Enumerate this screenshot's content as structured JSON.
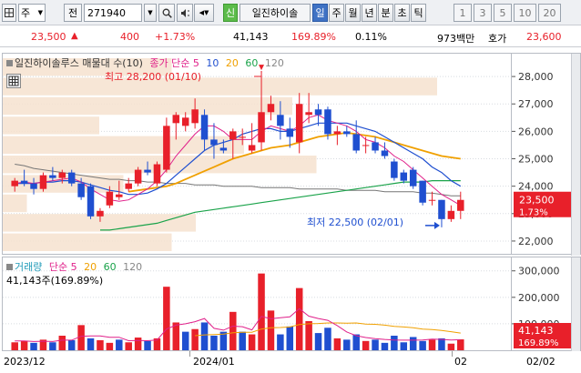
{
  "toolbar": {
    "market_label": "주",
    "field_label": "전",
    "code_value": "271940",
    "credit_badge": "신",
    "stock_name": "일진하이솔",
    "periods": [
      "일",
      "주",
      "월",
      "년",
      "분",
      "초",
      "틱"
    ],
    "selected_period": "일",
    "intervals": [
      "1",
      "3",
      "5",
      "10",
      "20"
    ]
  },
  "quote": {
    "price": "23,500",
    "change_arrow": "▲",
    "change": "400",
    "change_pct": "+1.73%",
    "volume": "41,143",
    "volume_ratio": "169.89%",
    "turnover": "0.11%",
    "amount": "973백만",
    "ask_label": "호가",
    "ask_price": "23,600"
  },
  "price_panel": {
    "legend_name": "일진하이솔루스 매물대 수(10)",
    "legend_close": "종가 단순",
    "ma_periods": [
      "5",
      "10",
      "20",
      "60",
      "120"
    ],
    "high_annotation": "최고 28,200 (01/10)",
    "low_annotation": "최저 22,500 (02/01)"
  },
  "price_axis": {
    "ticks": [
      "28,000",
      "27,000",
      "26,000",
      "25,000",
      "24,000",
      "23,000",
      "22,000"
    ],
    "current_price": "23,500",
    "current_pct": "1.73%"
  },
  "volume_panel": {
    "legend_name": "거래량",
    "legend_ma": "단순",
    "ma_periods": [
      "5",
      "20",
      "60",
      "120"
    ],
    "current_label": "41,143주(169.89%)"
  },
  "volume_axis": {
    "ticks": [
      "300,000",
      "200,000",
      "100,000"
    ],
    "current_volume": "41,143",
    "current_pct": "169.89%"
  },
  "date_axis": {
    "labels": [
      "2023/12",
      "2024/01",
      "02",
      "02/02"
    ]
  },
  "colors": {
    "up": "#e8202a",
    "down": "#1f4fd0",
    "ma5": "#e0208a",
    "ma10": "#1f4fd0",
    "ma20": "#f0a000",
    "ma60": "#1aa34a",
    "ma120": "#777777",
    "volume_profile": "#f6e2cf"
  },
  "chart_data": {
    "type": "candlestick",
    "ylim": [
      21600,
      28700
    ],
    "volume_ylim": [
      0,
      330000
    ],
    "candles": [
      {
        "o": 24000,
        "h": 24300,
        "l": 23800,
        "c": 24200
      },
      {
        "o": 24200,
        "h": 24600,
        "l": 24000,
        "c": 24100
      },
      {
        "o": 24100,
        "h": 24300,
        "l": 23700,
        "c": 23900
      },
      {
        "o": 23900,
        "h": 24500,
        "l": 23800,
        "c": 24400
      },
      {
        "o": 24400,
        "h": 24700,
        "l": 24200,
        "c": 24300
      },
      {
        "o": 24300,
        "h": 24600,
        "l": 24100,
        "c": 24500
      },
      {
        "o": 24500,
        "h": 24600,
        "l": 24000,
        "c": 24100
      },
      {
        "o": 24100,
        "h": 24300,
        "l": 23500,
        "c": 23600
      },
      {
        "o": 24000,
        "h": 24100,
        "l": 22800,
        "c": 22900
      },
      {
        "o": 22900,
        "h": 23200,
        "l": 22700,
        "c": 23100
      },
      {
        "o": 23300,
        "h": 24000,
        "l": 23200,
        "c": 23800
      },
      {
        "o": 23600,
        "h": 24200,
        "l": 23500,
        "c": 23700
      },
      {
        "o": 23900,
        "h": 24300,
        "l": 23800,
        "c": 24100
      },
      {
        "o": 24100,
        "h": 24700,
        "l": 24000,
        "c": 24600
      },
      {
        "o": 24600,
        "h": 24900,
        "l": 24400,
        "c": 24500
      },
      {
        "o": 24100,
        "h": 24900,
        "l": 24000,
        "c": 24800
      },
      {
        "o": 24600,
        "h": 26500,
        "l": 24500,
        "c": 26200
      },
      {
        "o": 26300,
        "h": 26700,
        "l": 25700,
        "c": 26600
      },
      {
        "o": 26200,
        "h": 26700,
        "l": 26000,
        "c": 26500
      },
      {
        "o": 26300,
        "h": 27200,
        "l": 26100,
        "c": 26800
      },
      {
        "o": 26600,
        "h": 26800,
        "l": 25300,
        "c": 25700
      },
      {
        "o": 25700,
        "h": 26300,
        "l": 25000,
        "c": 25500
      },
      {
        "o": 25400,
        "h": 25700,
        "l": 25200,
        "c": 25300
      },
      {
        "o": 25700,
        "h": 26100,
        "l": 25000,
        "c": 26000
      },
      {
        "o": 25800,
        "h": 26100,
        "l": 25500,
        "c": 25800
      },
      {
        "o": 25300,
        "h": 26300,
        "l": 25200,
        "c": 25500
      },
      {
        "o": 25600,
        "h": 28200,
        "l": 25300,
        "c": 26700
      },
      {
        "o": 26700,
        "h": 27300,
        "l": 26400,
        "c": 27000
      },
      {
        "o": 26600,
        "h": 27100,
        "l": 25700,
        "c": 26200
      },
      {
        "o": 26100,
        "h": 26500,
        "l": 25400,
        "c": 25800
      },
      {
        "o": 25600,
        "h": 27400,
        "l": 25200,
        "c": 27000
      },
      {
        "o": 26600,
        "h": 27400,
        "l": 26300,
        "c": 26700
      },
      {
        "o": 26800,
        "h": 27000,
        "l": 26200,
        "c": 26600
      },
      {
        "o": 26800,
        "h": 26900,
        "l": 25700,
        "c": 25900
      },
      {
        "o": 25900,
        "h": 26200,
        "l": 25500,
        "c": 26000
      },
      {
        "o": 26000,
        "h": 26200,
        "l": 25800,
        "c": 25900
      },
      {
        "o": 25900,
        "h": 26400,
        "l": 25200,
        "c": 25300
      },
      {
        "o": 25500,
        "h": 25800,
        "l": 25200,
        "c": 25500
      },
      {
        "o": 25600,
        "h": 25800,
        "l": 25200,
        "c": 25300
      },
      {
        "o": 25300,
        "h": 25600,
        "l": 25000,
        "c": 25100
      },
      {
        "o": 24900,
        "h": 25000,
        "l": 24200,
        "c": 24300
      },
      {
        "o": 24500,
        "h": 24600,
        "l": 24100,
        "c": 24200
      },
      {
        "o": 24600,
        "h": 24700,
        "l": 23900,
        "c": 24000
      },
      {
        "o": 24200,
        "h": 24200,
        "l": 23300,
        "c": 23400
      },
      {
        "o": 23500,
        "h": 23800,
        "l": 23300,
        "c": 23500
      },
      {
        "o": 23500,
        "h": 23500,
        "l": 22500,
        "c": 22800
      },
      {
        "o": 22800,
        "h": 23300,
        "l": 22700,
        "c": 23100
      },
      {
        "o": 23100,
        "h": 23800,
        "l": 22800,
        "c": 23500
      }
    ],
    "volume": [
      30000,
      35000,
      28000,
      40000,
      30000,
      55000,
      38000,
      95000,
      45000,
      38000,
      28000,
      40000,
      30000,
      48000,
      35000,
      45000,
      240000,
      105000,
      70000,
      80000,
      105000,
      55000,
      70000,
      145000,
      70000,
      60000,
      290000,
      150000,
      60000,
      90000,
      235000,
      110000,
      65000,
      85000,
      45000,
      40000,
      60000,
      35000,
      40000,
      28000,
      55000,
      30000,
      50000,
      35000,
      40000,
      45000,
      25000,
      41143
    ],
    "volume_is_up": [
      true,
      true,
      false,
      true,
      false,
      true,
      false,
      true,
      false,
      true,
      true,
      false,
      true,
      true,
      false,
      true,
      true,
      true,
      false,
      true,
      false,
      false,
      false,
      true,
      false,
      true,
      true,
      true,
      false,
      false,
      true,
      true,
      false,
      false,
      true,
      false,
      false,
      true,
      false,
      false,
      false,
      false,
      false,
      false,
      true,
      false,
      true,
      true
    ],
    "ma5": [
      24100,
      24150,
      24100,
      24150,
      24200,
      24250,
      24300,
      24150,
      23900,
      23700,
      23500,
      23450,
      23500,
      23700,
      23900,
      24200,
      24600,
      25100,
      25500,
      25900,
      26200,
      26200,
      26000,
      25700,
      25700,
      25700,
      26000,
      26200,
      26100,
      26000,
      26200,
      26500,
      26600,
      26400,
      26300,
      26200,
      26000,
      25700,
      25600,
      25400,
      25100,
      24900,
      24600,
      24300,
      24000,
      23700,
      23500,
      23300
    ],
    "ma10": [
      24100,
      24100,
      24100,
      24150,
      24150,
      24200,
      24200,
      24150,
      24050,
      23950,
      23850,
      23800,
      23700,
      23700,
      23750,
      23900,
      24100,
      24400,
      24700,
      25000,
      25300,
      25500,
      25600,
      25700,
      25900,
      26000,
      26100,
      26100,
      26000,
      26000,
      26100,
      26200,
      26300,
      26300,
      26300,
      26300,
      26200,
      26100,
      26000,
      25800,
      25600,
      25400,
      25200,
      25000,
      24700,
      24500,
      24200,
      24000
    ],
    "ma20": [
      null,
      null,
      null,
      null,
      null,
      null,
      null,
      null,
      null,
      null,
      null,
      null,
      23800,
      23850,
      23900,
      23950,
      24000,
      24100,
      24250,
      24400,
      24550,
      24700,
      24850,
      25000,
      25100,
      25200,
      25300,
      25400,
      25450,
      25500,
      25600,
      25700,
      25800,
      25850,
      25900,
      25950,
      25900,
      25850,
      25800,
      25700,
      25600,
      25500,
      25400,
      25300,
      25200,
      25100,
      25050,
      25000
    ],
    "ma60": [
      null,
      null,
      null,
      null,
      null,
      null,
      null,
      null,
      null,
      22400,
      22400,
      22450,
      22500,
      22550,
      22600,
      22650,
      22750,
      22850,
      22950,
      23050,
      23100,
      23150,
      23200,
      23250,
      23300,
      23350,
      23400,
      23450,
      23500,
      23550,
      23600,
      23650,
      23700,
      23750,
      23800,
      23850,
      23900,
      23950,
      24000,
      24050,
      24100,
      24150,
      24150,
      24150,
      24200,
      24200,
      24200,
      24200
    ],
    "ma120": [
      24800,
      24750,
      24650,
      24600,
      24550,
      24500,
      24450,
      24400,
      24350,
      24300,
      24250,
      24250,
      24200,
      24200,
      24150,
      24150,
      24100,
      24100,
      24100,
      24050,
      24050,
      24050,
      24000,
      24000,
      24000,
      24000,
      23950,
      23950,
      23950,
      23950,
      23900,
      23900,
      23900,
      23900,
      23900,
      23850,
      23850,
      23850,
      23850,
      23800,
      23800,
      23800,
      23800,
      23750,
      23750,
      23700,
      23650,
      23650
    ],
    "vol_ma5": [
      35000,
      35000,
      33000,
      34000,
      33000,
      38000,
      38000,
      53000,
      54000,
      54000,
      49000,
      49000,
      36000,
      37000,
      36000,
      39000,
      80000,
      95000,
      100000,
      108000,
      120000,
      83000,
      76000,
      91000,
      89000,
      77000,
      128000,
      119000,
      123000,
      126000,
      157000,
      129000,
      120000,
      113000,
      93000,
      69000,
      55000,
      48000,
      44000,
      41000,
      39000,
      38000,
      38000,
      39000,
      42000,
      41000,
      39000,
      40000
    ],
    "vol_ma20": [
      null,
      null,
      null,
      null,
      null,
      null,
      null,
      null,
      null,
      null,
      null,
      null,
      null,
      null,
      null,
      null,
      null,
      null,
      null,
      55000,
      58000,
      59000,
      61000,
      66000,
      68000,
      68000,
      80000,
      85000,
      86000,
      88000,
      97000,
      100000,
      101000,
      103000,
      103000,
      102000,
      103000,
      99000,
      98000,
      95000,
      90000,
      88000,
      85000,
      80000,
      78000,
      75000,
      70000,
      65000
    ],
    "volume_profile": [
      0.35,
      0.9,
      0.6,
      0.2,
      0.5,
      0.65,
      0.25,
      0.05,
      0.4,
      0.35
    ]
  }
}
